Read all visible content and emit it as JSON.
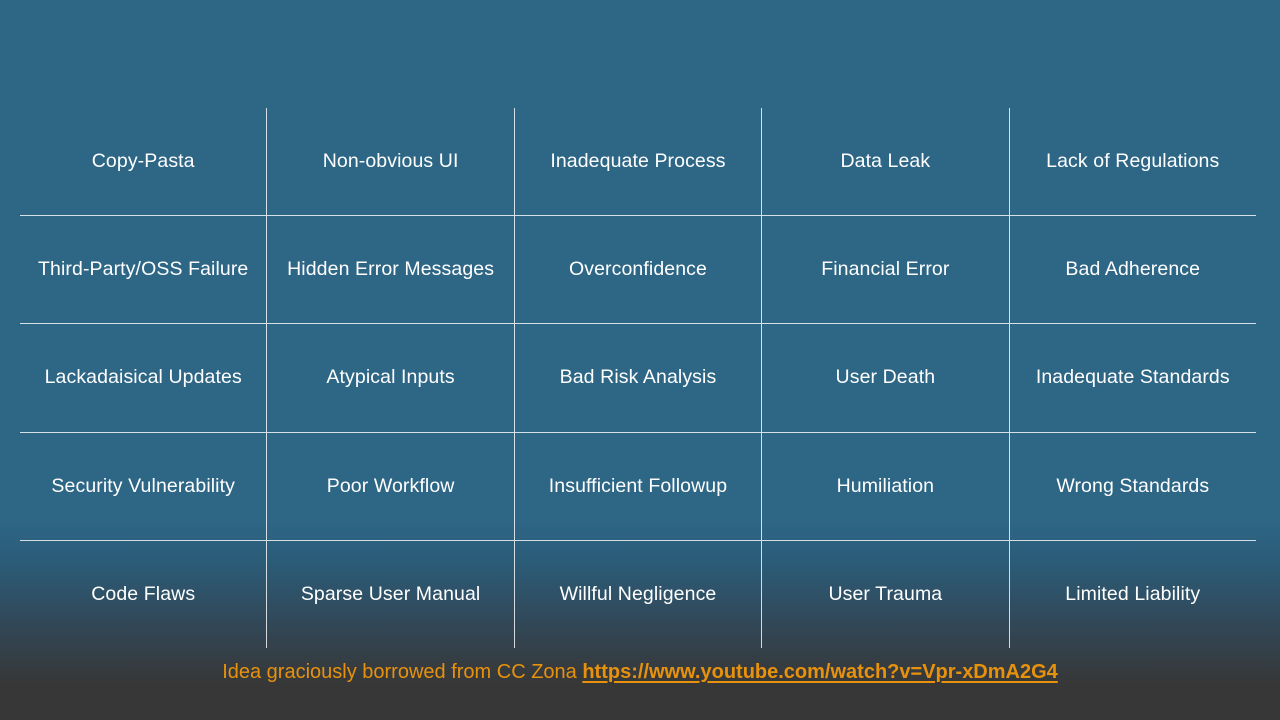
{
  "slide": {
    "background_top_color": "#2e6686",
    "background_bottom_color": "#373737",
    "text_color": "#ffffff",
    "grid_line_color": "#ffffff"
  },
  "matrix": {
    "columns": 5,
    "rows": 5,
    "cells": [
      [
        "Copy-Pasta",
        "Non-obvious UI",
        "Inadequate Process",
        "Data Leak",
        "Lack of Regulations"
      ],
      [
        "Third-Party/OSS Failure",
        "Hidden Error Messages",
        "Overconfidence",
        "Financial Error",
        "Bad Adherence"
      ],
      [
        "Lackadaisical Updates",
        "Atypical Inputs",
        "Bad Risk Analysis",
        "User Death",
        "Inadequate Standards"
      ],
      [
        "Security Vulnerability",
        "Poor Workflow",
        "Insufficient Followup",
        "Humiliation",
        "Wrong Standards"
      ],
      [
        "Code Flaws",
        "Sparse User Manual",
        "Willful Negligence",
        "User Trauma",
        "Limited Liability"
      ]
    ]
  },
  "footer": {
    "credit_text": "Idea graciously borrowed from CC Zona ",
    "url_text": "https://www.youtube.com/watch?v=Vpr-xDmA2G4",
    "accent_color": "#e8920c"
  }
}
